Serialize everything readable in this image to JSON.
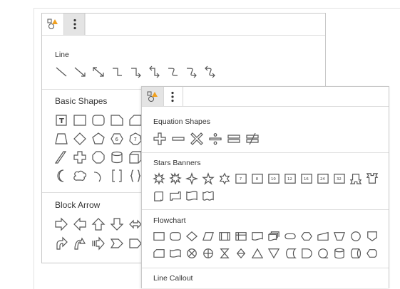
{
  "panel_back": {
    "sections": [
      {
        "title": "Line"
      },
      {
        "title": "Basic Shapes"
      },
      {
        "title": "Block Arrow"
      }
    ]
  },
  "panel_front": {
    "sections": [
      {
        "title": "Equation Shapes"
      },
      {
        "title": "Stars Banners"
      },
      {
        "title": "Flowchart"
      },
      {
        "title": "Line Callout"
      }
    ],
    "star_numbers": [
      "7",
      "8",
      "10",
      "12",
      "16",
      "24",
      "32"
    ]
  },
  "icons": {
    "shapes_tool": "shapes-palette-icon",
    "more_menu": "vertical-ellipsis-icon"
  },
  "colors": {
    "icon_stroke": "#555555",
    "toolbar_active_bg": "#e4e4e4",
    "shapes_tool_accent": "#f0a020"
  }
}
